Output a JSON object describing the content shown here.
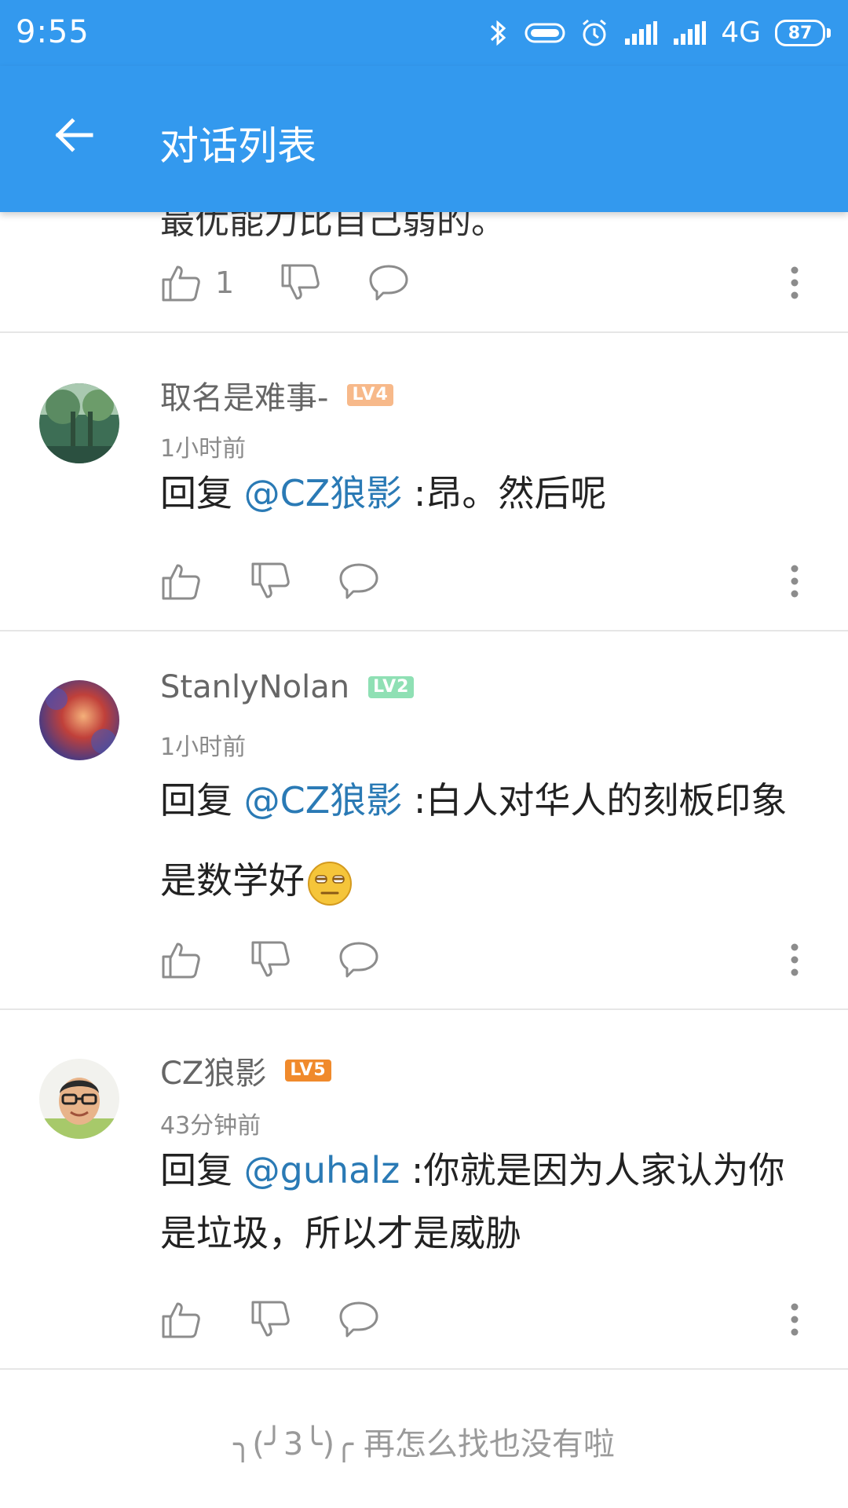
{
  "status_bar": {
    "time": "9:55",
    "network": "4G",
    "battery": "87"
  },
  "app_bar": {
    "title": "对话列表"
  },
  "top_partial": {
    "text": "最优能力比自己弱的。",
    "like_count": "1"
  },
  "comments": [
    {
      "username": "取名是难事-",
      "level": "LV4",
      "level_color": "#f7b98a",
      "time": "1小时前",
      "reply_prefix": "回复",
      "mention": "@CZ狼影",
      "text": ":昂。然后呢"
    },
    {
      "username": "StanlyNolan",
      "level": "LV2",
      "level_color": "#8fe0b4",
      "time": "1小时前",
      "reply_prefix": "回复",
      "mention": "@CZ狼影",
      "text": ":白人对华人的刻板印象是数学好",
      "emoji": "smirk-face-emoji"
    },
    {
      "username": "CZ狼影",
      "level": "LV5",
      "level_color": "#f08a2c",
      "time": "43分钟前",
      "reply_prefix": "回复",
      "mention": "@guhalz",
      "text": ":你就是因为人家认为你是垃圾，所以才是威胁"
    }
  ],
  "footer": {
    "face": "╮(╯3╰)╭",
    "text": "再怎么找也没有啦"
  },
  "colors": {
    "primary": "#3399ee",
    "mention": "#2a7ab5"
  }
}
